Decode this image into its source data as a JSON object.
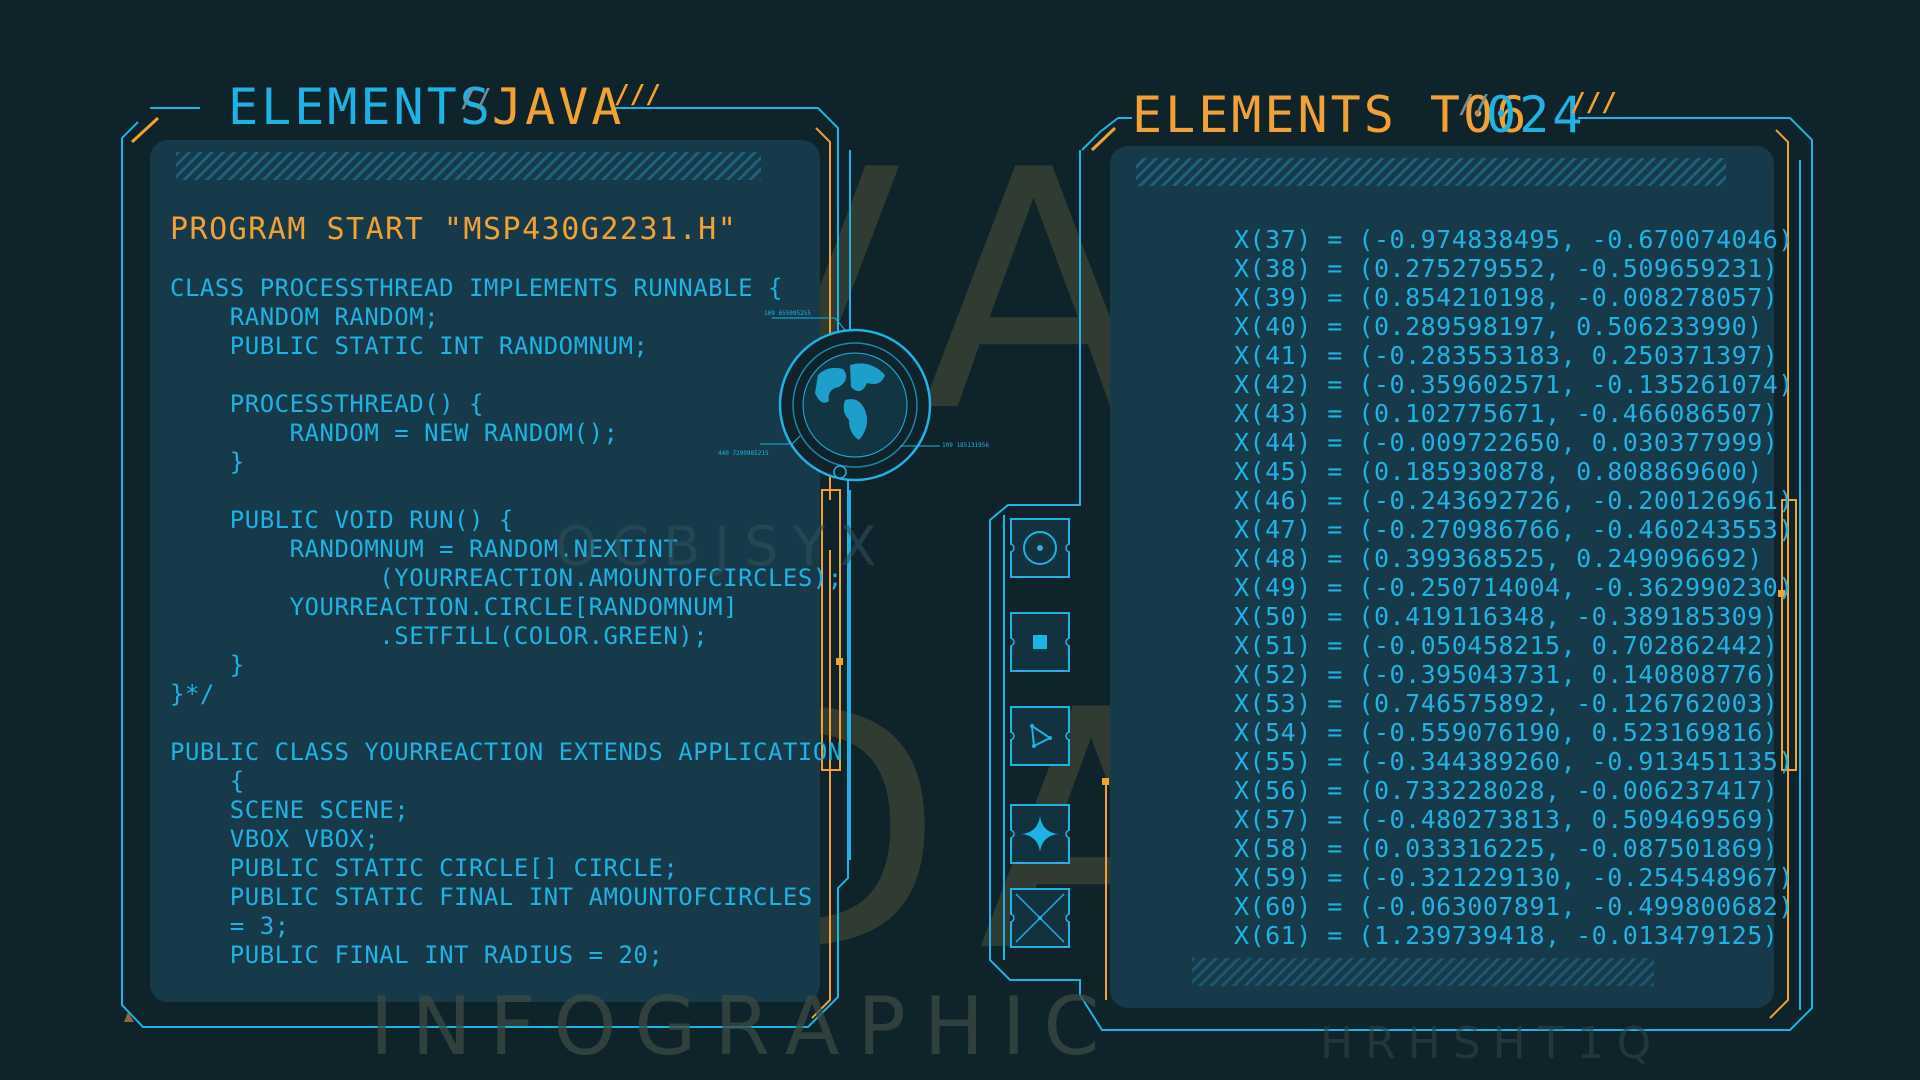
{
  "left_panel": {
    "title_part1": "ELEMENTS",
    "title_part2": "JAVA",
    "heading": "PROGRAM START \"MSP430G2231.H\"",
    "code_lines": [
      "CLASS PROCESSTHREAD IMPLEMENTS RUNNABLE {",
      "    RANDOM RANDOM;",
      "    PUBLIC STATIC INT RANDOMNUM;",
      "",
      "    PROCESSTHREAD() {",
      "        RANDOM = NEW RANDOM();",
      "    }",
      "",
      "    PUBLIC VOID RUN() {",
      "        RANDOMNUM = RANDOM.NEXTINT",
      "              (YOURREACTION.AMOUNTOFCIRCLES);",
      "        YOURREACTION.CIRCLE[RANDOMNUM]",
      "              .SETFILL(COLOR.GREEN);",
      "    }",
      "}*/",
      "",
      "PUBLIC CLASS YOURREACTION EXTENDS APPLICATION",
      "    {",
      "    SCENE SCENE;",
      "    VBOX VBOX;",
      "    PUBLIC STATIC CIRCLE[] CIRCLE;",
      "    PUBLIC STATIC FINAL INT AMOUNTOFCIRCLES",
      "    = 3;",
      "    PUBLIC FINAL INT RADIUS = 20;"
    ]
  },
  "right_panel": {
    "title_part1": "ELEMENTS T06",
    "title_part2": "024",
    "data_lines": [
      "X(37) = (-0.974838495, -0.670074046)",
      "X(38) = (0.275279552, -0.509659231)",
      "X(39) = (0.854210198, -0.008278057)",
      "X(40) = (0.289598197, 0.506233990)",
      "X(41) = (-0.283553183, 0.250371397)",
      "X(42) = (-0.359602571, -0.135261074)",
      "X(43) = (0.102775671, -0.466086507)",
      "X(44) = (-0.009722650, 0.030377999)",
      "X(45) = (0.185930878, 0.808869600)",
      "X(46) = (-0.243692726, -0.200126961)",
      "X(47) = (-0.270986766, -0.460243553)",
      "X(48) = (0.399368525, 0.249096692)",
      "X(49) = (-0.250714004, -0.362990230)",
      "X(50) = (0.419116348, -0.389185309)",
      "X(51) = (-0.050458215, 0.702862442)",
      "X(52) = (-0.395043731, 0.140808776)",
      "X(53) = (0.746575892, -0.126762003)",
      "X(54) = (-0.559076190, 0.523169816)",
      "X(55) = (-0.344389260, -0.913451135)",
      "X(56) = (0.733228028, -0.006237417)",
      "X(57) = (-0.480273813, 0.509469569)",
      "X(58) = (0.033316225, -0.087501869)",
      "X(59) = (-0.321229130, -0.254548967)",
      "X(60) = (-0.063007891, -0.499800682)",
      "X(61) = (1.239739418, -0.013479125)"
    ]
  },
  "watermarks": {
    "java": "JAVA",
    "data": "DATA",
    "infographic": "INFOGRAPHIC",
    "left_small": "OCBJSYX",
    "right_small": "HRHSHT1Q"
  },
  "side_icons": [
    "target-icon",
    "square-icon",
    "triangle-icon",
    "star-icon",
    "crosshair-icon"
  ],
  "colors": {
    "background": "#0f232b",
    "panel": "#163a4a",
    "cyan": "#1fb2e2",
    "orange": "#f2a134"
  }
}
